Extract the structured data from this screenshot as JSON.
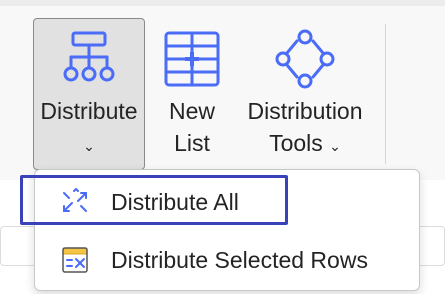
{
  "ribbon": {
    "distribute": {
      "line1": "Distribute",
      "chevron": "⌄",
      "icon": "hierarchy-icon"
    },
    "new_list": {
      "line1": "New",
      "line2": "List",
      "icon": "grid-plus-icon"
    },
    "distribution_tools": {
      "line1": "Distribution",
      "line2": "Tools",
      "chevron": "⌄",
      "icon": "network-icon"
    }
  },
  "menu": {
    "items": [
      {
        "label": "Distribute All",
        "icon": "distribute-arrows-icon"
      },
      {
        "label": "Distribute Selected Rows",
        "icon": "table-distribute-icon"
      }
    ]
  },
  "colors": {
    "accent": "#4a6cf7",
    "focus": "#3942b8",
    "highlight": "#f4c542"
  }
}
